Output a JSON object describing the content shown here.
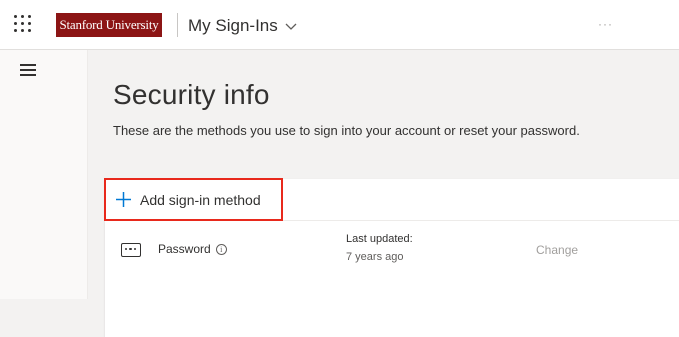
{
  "header": {
    "brand": "Stanford University",
    "app_title": "My Sign-Ins",
    "more_label": "···",
    "colors": {
      "brand": "#8c1515",
      "highlight": "#e8291c"
    }
  },
  "main": {
    "title": "Security info",
    "subtitle": "These are the methods you use to sign into your account or reset your password.",
    "add_method_label": "Add sign-in method",
    "methods": [
      {
        "icon": "password-icon",
        "name": "Password",
        "updated_label": "Last updated:",
        "updated_value": "7 years ago",
        "action_label": "Change"
      }
    ]
  }
}
